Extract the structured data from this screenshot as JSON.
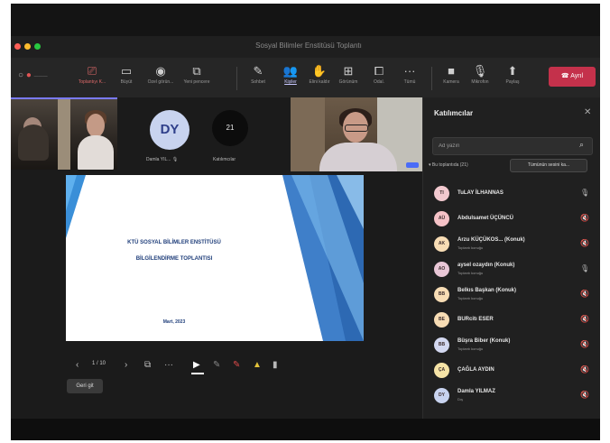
{
  "window": {
    "title": "Sosyal Bilimler Enstitüsü Toplantı",
    "traffic_colors": [
      "#fe5f57",
      "#febc2e",
      "#28c840"
    ]
  },
  "toolbar": {
    "left_status": "",
    "items": [
      {
        "icon": "⎚",
        "label": "Toplantıyı K...",
        "icon_name": "record-icon",
        "state": "active"
      },
      {
        "icon": "▭",
        "label": "Büyüt",
        "icon_name": "expand-icon",
        "state": ""
      },
      {
        "icon": "◉",
        "label": "Özel görün...",
        "icon_name": "view-icon",
        "state": ""
      },
      {
        "icon": "⧉",
        "label": "Yeni pencere",
        "icon_name": "new-window-icon",
        "state": ""
      },
      {
        "icon": "✎",
        "label": "Sohbet",
        "icon_name": "chat-icon",
        "state": ""
      },
      {
        "icon": "👥",
        "label": "Kişiler",
        "icon_name": "people-icon",
        "state": "selected"
      },
      {
        "icon": "✋",
        "label": "Elini kaldır",
        "icon_name": "raise-hand-icon",
        "state": ""
      },
      {
        "icon": "⊞",
        "label": "Görünüm",
        "icon_name": "layout-icon",
        "state": ""
      },
      {
        "icon": "⧠",
        "label": "Odal.",
        "icon_name": "rooms-icon",
        "state": ""
      },
      {
        "icon": "···",
        "label": "Tümü",
        "icon_name": "more-icon",
        "state": ""
      },
      {
        "icon": "■",
        "label": "Kamera",
        "icon_name": "camera-icon",
        "state": ""
      },
      {
        "icon": "🎙",
        "label": "Mikrofon",
        "icon_name": "mic-icon",
        "state": ""
      },
      {
        "icon": "⬆",
        "label": "Paylaş",
        "icon_name": "share-icon",
        "state": ""
      }
    ],
    "leave_label": "Ayrıl",
    "leave_color": "#c4314b"
  },
  "stage": {
    "tile_dy": {
      "initials": "DY",
      "name": "Damla YIL..."
    },
    "tile_count": {
      "count": "21",
      "label": "Katılımcılar"
    },
    "slide": {
      "title_line1": "KTÜ SOSYAL BİLİMLER ENSTİTÜSÜ",
      "title_line2": "BİLGİLENDİRME TOPLANTISI",
      "date": "Mart, 2023"
    },
    "controls": {
      "page_indicator": "1 / 10",
      "back_button": "Geri git"
    }
  },
  "panel": {
    "title": "Katılımcılar",
    "search_placeholder": "Ad yazın",
    "section_label": "Bu toplantıda (21)",
    "mute_all_button": "Tümünün sesini ka...",
    "participants": [
      {
        "initials": "TI",
        "name": "TuLAY İLHANNAS",
        "role": "",
        "mic": "unmuted",
        "avatar_color": "#f2c9cf"
      },
      {
        "initials": "AÜ",
        "name": "Abdulsamet ÜÇÜNCÜ",
        "role": "",
        "mic": "muted",
        "avatar_color": "#f5c2c7"
      },
      {
        "initials": "AK",
        "name": "Arzu KÜÇÜKOS... (Konuk)",
        "role": "Toplantı konuğu",
        "mic": "muted",
        "avatar_color": "#f7dcb4"
      },
      {
        "initials": "AO",
        "name": "aysel ozaydın (Konuk)",
        "role": "Toplantı konuğu",
        "mic": "unmuted",
        "avatar_color": "#e8c6d6"
      },
      {
        "initials": "BB",
        "name": "Belkıs Başkan (Konuk)",
        "role": "Toplantı konuğu",
        "mic": "muted",
        "avatar_color": "#f7dcb4"
      },
      {
        "initials": "BE",
        "name": "BURcitı ESER",
        "role": "",
        "mic": "muted",
        "avatar_color": "#f7dcb4"
      },
      {
        "initials": "BB",
        "name": "Büşra Biber (Konuk)",
        "role": "Toplantı konuğu",
        "mic": "muted",
        "avatar_color": "#d3d8f0"
      },
      {
        "initials": "ÇA",
        "name": "ÇAĞLA AYDIN",
        "role": "",
        "mic": "muted",
        "avatar_color": "#f5e3a6"
      },
      {
        "initials": "DY",
        "name": "Damla YILMAZ",
        "role": "Dış",
        "mic": "muted",
        "avatar_color": "#c8d3ef"
      }
    ]
  }
}
